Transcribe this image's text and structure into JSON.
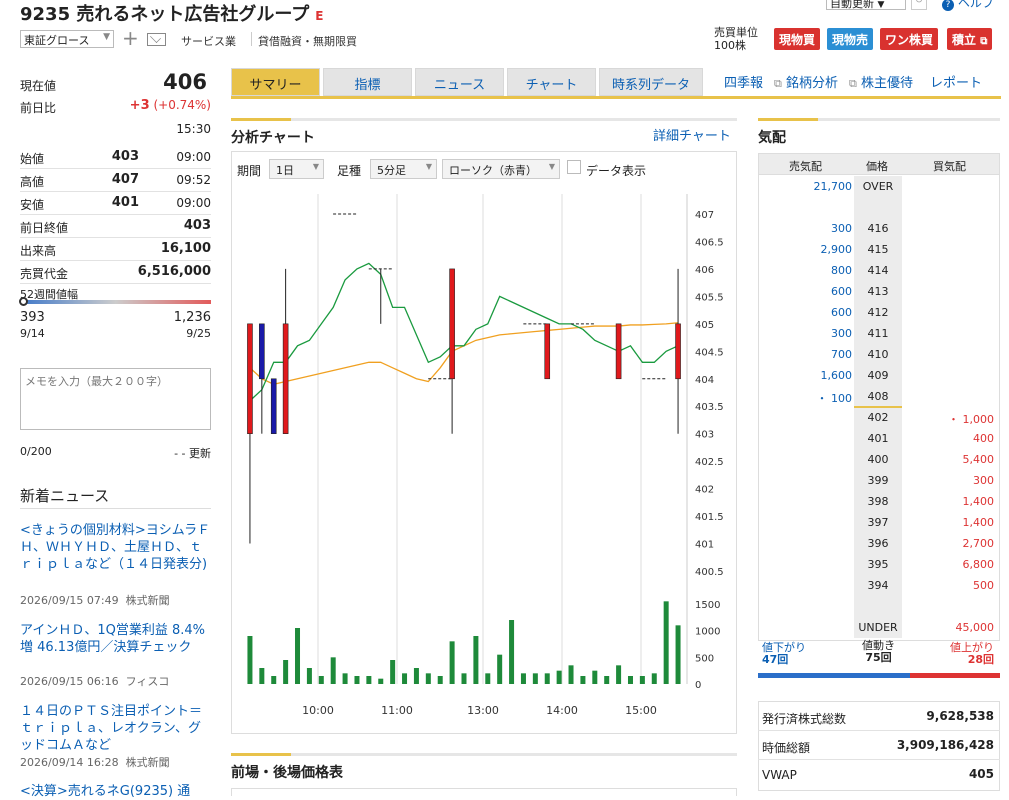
{
  "header": {
    "title": "9235 売れるネット広告社グループ",
    "e_badge": "E",
    "market": "東証グロース",
    "industry": "サービス業",
    "margin": "貸借融資・無期限買",
    "auto_update": "自動更新",
    "help": "ヘルプ",
    "unit_label": "売買単位",
    "unit_value": "100株",
    "btn_genbutsu_buy": "現物買",
    "btn_genbutsu_sell": "現物売",
    "btn_one": "ワン株買",
    "btn_tsumitate": "積立"
  },
  "price": {
    "current_label": "現在値",
    "current": "406",
    "change_label": "前日比",
    "change": "+3",
    "change_pct": "(+0.74%)",
    "time": "15:30",
    "rows": [
      {
        "label": "始値",
        "value": "403",
        "time": "09:00"
      },
      {
        "label": "高値",
        "value": "407",
        "time": "09:52"
      },
      {
        "label": "安値",
        "value": "401",
        "time": "09:00"
      }
    ],
    "prev_close_label": "前日終値",
    "prev_close": "403",
    "volume_label": "出来高",
    "volume": "16,100",
    "turnover_label": "売買代金",
    "turnover": "6,516,000",
    "week52_label": "52週間値幅",
    "week52_low": "393",
    "week52_high": "1,236",
    "week52_low_date": "9/14",
    "week52_high_date": "9/25",
    "week52_position": 0.015
  },
  "memo": {
    "placeholder": "メモを入力（最大２００字）",
    "count": "0/200",
    "update": "- - 更新"
  },
  "news": {
    "title": "新着ニュース",
    "items": [
      {
        "text": "<きょうの個別材料>ヨシムラＦＨ、ＷＨＹＨＤ、土屋ＨＤ、ｔｒｉｐｌａなど（１４日発表分)",
        "date": "2026/09/15 07:49",
        "source": "株式新聞"
      },
      {
        "text": "アインＨＤ、1Q営業利益 8.4%増 46.13億円／決算チェック",
        "date": "2026/09/15 06:16",
        "source": "フィスコ"
      },
      {
        "text": "１４日のＰＴＳ注目ポイント＝ｔｒｉｐｌａ、レオクラン、グッドコムＡなど",
        "date": "2026/09/14 16:28",
        "source": "株式新聞"
      },
      {
        "text": "<決算>売れるネG(9235) 通"
      }
    ]
  },
  "tabs": [
    "サマリー",
    "指標",
    "ニュース",
    "チャート",
    "時系列データ"
  ],
  "tab_links": [
    "四季報",
    "銘柄分析",
    "株主優待",
    "レポート"
  ],
  "chart_section": {
    "title": "分析チャート",
    "detail_link": "詳細チャート",
    "period_label": "期間",
    "period_value": "1日",
    "ashi_label": "足種",
    "ashi_value": "5分足",
    "candle_value": "ローソク（赤青）",
    "data_display": "データ表示"
  },
  "chart_data": {
    "type": "candlestick",
    "x_ticks": [
      "10:00",
      "11:00",
      "13:00",
      "14:00",
      "15:00"
    ],
    "price_ticks": [
      "407",
      "406.5",
      "406",
      "405.5",
      "405",
      "404.5",
      "404",
      "403.5",
      "403",
      "402.5",
      "402",
      "401.5",
      "401",
      "400.5"
    ],
    "ylim": [
      400.5,
      407
    ],
    "volume_ticks": [
      "1500",
      "1000",
      "500",
      "0"
    ],
    "volume_lim": [
      0,
      1500
    ],
    "candles": [
      {
        "t": 0,
        "o": 405,
        "h": 405,
        "l": 401,
        "c": 403,
        "color": "red"
      },
      {
        "t": 1,
        "o": 405,
        "h": 405,
        "l": 403,
        "c": 404,
        "color": "blue"
      },
      {
        "t": 2,
        "o": 404,
        "h": 404,
        "l": 403,
        "c": 403,
        "color": "blue"
      },
      {
        "t": 3,
        "o": 403,
        "h": 406,
        "l": 403,
        "c": 405,
        "color": "red"
      },
      {
        "t": 8,
        "o": 407,
        "h": 407,
        "l": 407,
        "c": 407,
        "color": "flat"
      },
      {
        "t": 11,
        "o": 406,
        "h": 406,
        "l": 405,
        "c": 406,
        "color": "flat"
      },
      {
        "t": 16,
        "o": 404,
        "h": 404,
        "l": 404,
        "c": 404,
        "color": "flat"
      },
      {
        "t": 17,
        "o": 406,
        "h": 406,
        "l": 403,
        "c": 404,
        "color": "red"
      },
      {
        "t": 24,
        "o": 405,
        "h": 405,
        "l": 405,
        "c": 405,
        "color": "flat"
      },
      {
        "t": 25,
        "o": 404,
        "h": 405,
        "l": 404,
        "c": 405,
        "color": "red"
      },
      {
        "t": 28,
        "o": 405,
        "h": 405,
        "l": 405,
        "c": 405,
        "color": "flat"
      },
      {
        "t": 31,
        "o": 404,
        "h": 405,
        "l": 404,
        "c": 405,
        "color": "red"
      },
      {
        "t": 34,
        "o": 404,
        "h": 404,
        "l": 404,
        "c": 404,
        "color": "flat"
      },
      {
        "t": 36,
        "o": 404,
        "h": 406,
        "l": 403,
        "c": 405,
        "color": "red"
      }
    ],
    "line_green": [
      403.6,
      403.8,
      404.3,
      404.3,
      404.6,
      404.7,
      405.0,
      405.3,
      405.8,
      406.0,
      406.1,
      405.9,
      405.3,
      405.3,
      404.8,
      404.3,
      404.4,
      404.6,
      404.6,
      404.9,
      405.0,
      405.5,
      405.4,
      405.3,
      405.2,
      405.1,
      405.0,
      405.0,
      404.9,
      404.7,
      404.6,
      404.5,
      404.6,
      404.3,
      404.3,
      404.5,
      404.6
    ],
    "line_orange": [
      404.2,
      404.0,
      403.9,
      403.95,
      404.0,
      404.05,
      404.1,
      404.15,
      404.2,
      404.25,
      404.3,
      404.3,
      404.2,
      404.1,
      404.0,
      403.95,
      404.2,
      404.5,
      404.6,
      404.7,
      404.75,
      404.8,
      404.82,
      404.84,
      404.86,
      404.88,
      404.9,
      404.92,
      404.94,
      404.96,
      404.96,
      404.96,
      404.98,
      404.98,
      404.99,
      405.0,
      405.02
    ],
    "volume_bars": [
      900,
      300,
      150,
      450,
      1050,
      300,
      150,
      500,
      200,
      150,
      150,
      100,
      450,
      200,
      300,
      200,
      150,
      800,
      200,
      900,
      200,
      550,
      1200,
      200,
      200,
      200,
      250,
      350,
      150,
      250,
      150,
      350,
      150,
      150,
      200,
      1550,
      1100
    ],
    "total_points": 37
  },
  "board": {
    "title": "気配",
    "col_sell": "売気配",
    "col_price": "価格",
    "col_buy": "買気配",
    "rows": [
      {
        "s": "21,700",
        "p": "OVER",
        "b": ""
      },
      {
        "s": "",
        "p": "",
        "b": ""
      },
      {
        "s": "300",
        "p": "416",
        "b": ""
      },
      {
        "s": "2,900",
        "p": "415",
        "b": ""
      },
      {
        "s": "800",
        "p": "414",
        "b": ""
      },
      {
        "s": "600",
        "p": "413",
        "b": ""
      },
      {
        "s": "600",
        "p": "412",
        "b": ""
      },
      {
        "s": "300",
        "p": "411",
        "b": ""
      },
      {
        "s": "700",
        "p": "410",
        "b": ""
      },
      {
        "s": "1,600",
        "p": "409",
        "b": ""
      },
      {
        "s": "・ 100",
        "p": "408",
        "b": ""
      },
      {
        "s": "",
        "p": "402",
        "b": "・ 1,000"
      },
      {
        "s": "",
        "p": "401",
        "b": "400"
      },
      {
        "s": "",
        "p": "400",
        "b": "5,400"
      },
      {
        "s": "",
        "p": "399",
        "b": "300"
      },
      {
        "s": "",
        "p": "398",
        "b": "1,400"
      },
      {
        "s": "",
        "p": "397",
        "b": "1,400"
      },
      {
        "s": "",
        "p": "396",
        "b": "2,700"
      },
      {
        "s": "",
        "p": "395",
        "b": "6,800"
      },
      {
        "s": "",
        "p": "394",
        "b": "500"
      },
      {
        "s": "",
        "p": "",
        "b": ""
      },
      {
        "s": "",
        "p": "UNDER",
        "b": "45,000"
      }
    ],
    "down_label": "値下がり",
    "down_count": "47回",
    "move_label": "値動き",
    "move_count": "75回",
    "up_label": "値上がり",
    "up_count": "28回"
  },
  "stats": {
    "rows": [
      {
        "label": "発行済株式総数",
        "value": "9,628,538"
      },
      {
        "label": "時価総額",
        "value": "3,909,186,428"
      },
      {
        "label": "VWAP",
        "value": "405"
      }
    ]
  },
  "bottom": {
    "title": "前場・後場価格表"
  },
  "colors": {
    "accent": "#e8c24a",
    "up": "#d33",
    "down": "#0b5fb3",
    "candle_red": "#e0191c",
    "candle_blue": "#1a1aa8",
    "line_green": "#1a9a3f",
    "line_orange": "#f0a020",
    "volume": "#1e8a3a"
  }
}
